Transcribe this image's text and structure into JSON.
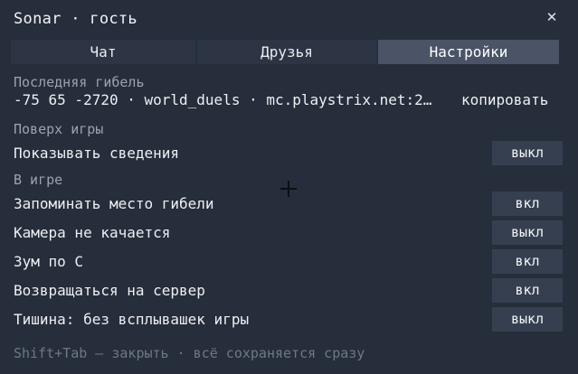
{
  "window": {
    "title": "Sonar · гость",
    "close_glyph": "✕"
  },
  "tabs": [
    {
      "label": "Чат",
      "active": false
    },
    {
      "label": "Друзья",
      "active": false
    },
    {
      "label": "Настройки",
      "active": true
    }
  ],
  "last_death": {
    "heading": "Последняя гибель",
    "info": "-75 65 -2720 · world_duels · mc.playstrix.net:2…",
    "copy_label": "копировать"
  },
  "overlay": {
    "heading": "Поверх игры",
    "settings": [
      {
        "label": "Показывать сведения",
        "toggle": "выкл"
      }
    ]
  },
  "ingame": {
    "heading": "В игре",
    "settings": [
      {
        "label": "Запоминать место гибели",
        "toggle": "вкл"
      },
      {
        "label": "Камера не качается",
        "toggle": "выкл"
      },
      {
        "label": "Зум по C",
        "toggle": "вкл"
      },
      {
        "label": "Возвращаться на сервер",
        "toggle": "вкл"
      },
      {
        "label": "Тишина: без всплывашек игры",
        "toggle": "выкл"
      }
    ]
  },
  "footer": "Shift+Tab — закрыть · всё сохраняется сразу",
  "colors": {
    "panel": "#262d3b",
    "tab_active": "#4a5466",
    "toggle_bg": "#363f50",
    "muted_text": "#9ba3b1"
  }
}
